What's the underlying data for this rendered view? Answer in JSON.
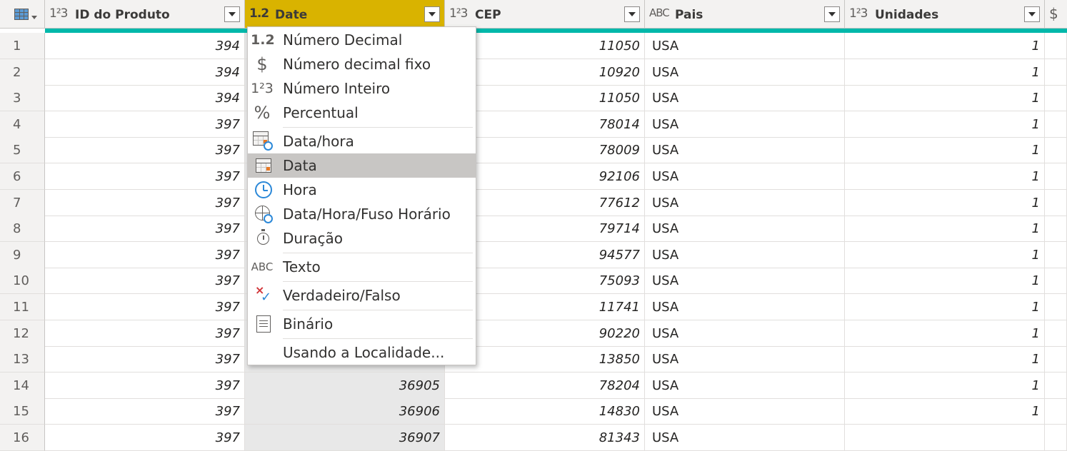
{
  "columns": [
    {
      "name": "ID do Produto",
      "type_icon": "1²3"
    },
    {
      "name": "Date",
      "type_icon": "1.2",
      "selected": true
    },
    {
      "name": "CEP",
      "type_icon": "1²3"
    },
    {
      "name": "Pais",
      "type_icon": "ABC"
    },
    {
      "name": "Unidades",
      "type_icon": "1²3"
    },
    {
      "name": "",
      "type_icon": "$"
    }
  ],
  "rows": [
    {
      "n": "1",
      "id": "394",
      "date": "",
      "cep": "11050",
      "pais": "USA",
      "unid": "1"
    },
    {
      "n": "2",
      "id": "394",
      "date": "",
      "cep": "10920",
      "pais": "USA",
      "unid": "1"
    },
    {
      "n": "3",
      "id": "394",
      "date": "",
      "cep": "11050",
      "pais": "USA",
      "unid": "1"
    },
    {
      "n": "4",
      "id": "397",
      "date": "",
      "cep": "78014",
      "pais": "USA",
      "unid": "1"
    },
    {
      "n": "5",
      "id": "397",
      "date": "",
      "cep": "78009",
      "pais": "USA",
      "unid": "1"
    },
    {
      "n": "6",
      "id": "397",
      "date": "",
      "cep": "92106",
      "pais": "USA",
      "unid": "1"
    },
    {
      "n": "7",
      "id": "397",
      "date": "",
      "cep": "77612",
      "pais": "USA",
      "unid": "1"
    },
    {
      "n": "8",
      "id": "397",
      "date": "",
      "cep": "79714",
      "pais": "USA",
      "unid": "1"
    },
    {
      "n": "9",
      "id": "397",
      "date": "",
      "cep": "94577",
      "pais": "USA",
      "unid": "1"
    },
    {
      "n": "10",
      "id": "397",
      "date": "",
      "cep": "75093",
      "pais": "USA",
      "unid": "1"
    },
    {
      "n": "11",
      "id": "397",
      "date": "",
      "cep": "11741",
      "pais": "USA",
      "unid": "1"
    },
    {
      "n": "12",
      "id": "397",
      "date": "",
      "cep": "90220",
      "pais": "USA",
      "unid": "1"
    },
    {
      "n": "13",
      "id": "397",
      "date": "",
      "cep": "13850",
      "pais": "USA",
      "unid": "1"
    },
    {
      "n": "14",
      "id": "397",
      "date": "36905",
      "cep": "78204",
      "pais": "USA",
      "unid": "1"
    },
    {
      "n": "15",
      "id": "397",
      "date": "36906",
      "cep": "14830",
      "pais": "USA",
      "unid": "1"
    },
    {
      "n": "16",
      "id": "397",
      "date": "36907",
      "cep": "81343",
      "pais": "USA",
      "unid": ""
    }
  ],
  "menu": {
    "items": [
      {
        "icon": "1.2",
        "label": "Número Decimal"
      },
      {
        "icon": "$",
        "label": "Número decimal fixo"
      },
      {
        "icon": "1²3",
        "label": "Número Inteiro"
      },
      {
        "icon": "%",
        "label": "Percentual"
      },
      {
        "icon": "datetime",
        "label": "Data/hora"
      },
      {
        "icon": "date",
        "label": "Data",
        "highlighted": true
      },
      {
        "icon": "time",
        "label": "Hora"
      },
      {
        "icon": "datetimezone",
        "label": "Data/Hora/Fuso Horário"
      },
      {
        "icon": "duration",
        "label": "Duração"
      },
      {
        "icon": "ABC",
        "label": "Texto"
      },
      {
        "icon": "truefalse",
        "label": "Verdadeiro/Falso"
      },
      {
        "icon": "binary",
        "label": "Binário"
      },
      {
        "icon": "",
        "label": "Usando a Localidade..."
      }
    ]
  },
  "colors": {
    "selected_header": "#d9b300",
    "quality_bar": "#01b8aa",
    "highlight": "#c8c6c4"
  }
}
